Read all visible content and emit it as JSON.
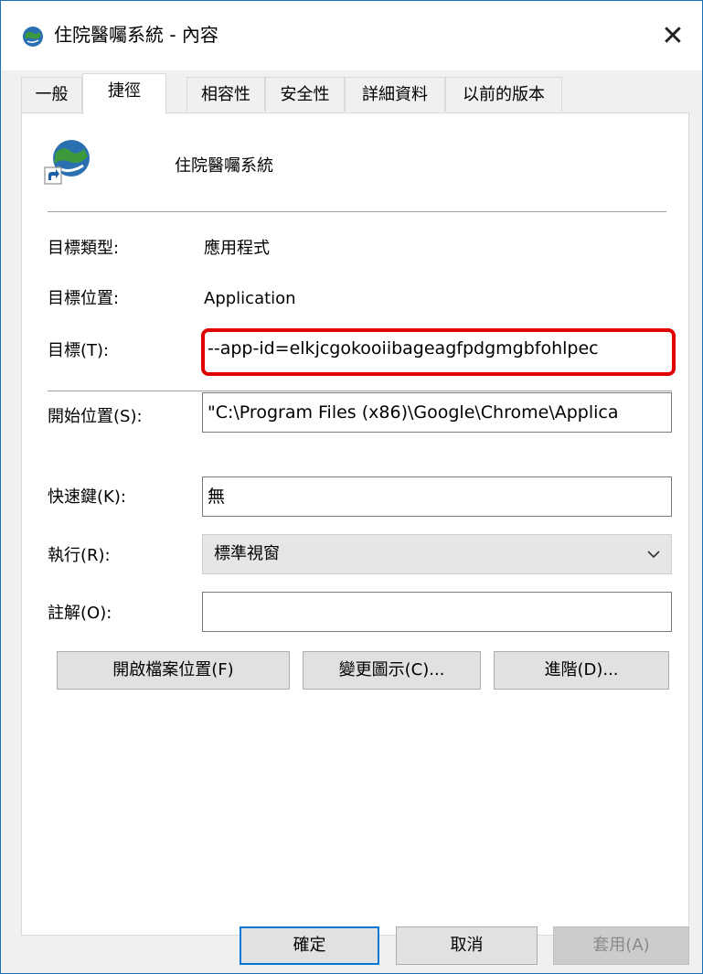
{
  "window": {
    "title": "住院醫囑系統 - 內容",
    "close_glyph": "✕"
  },
  "tabs": [
    {
      "label": "一般"
    },
    {
      "label": "捷徑"
    },
    {
      "label": "相容性"
    },
    {
      "label": "安全性"
    },
    {
      "label": "詳細資料"
    },
    {
      "label": "以前的版本"
    }
  ],
  "shortcut": {
    "name": "住院醫囑系統",
    "target_type_label": "目標類型:",
    "target_type_value": "應用程式",
    "target_location_label": "目標位置:",
    "target_location_value": "Application",
    "target_label": "目標(T):",
    "target_value": "--app-id=elkjcgokooiibageagfpdgmgbfohlpec",
    "start_in_label": "開始位置(S):",
    "start_in_value": "\"C:\\Program Files (x86)\\Google\\Chrome\\Applica",
    "shortcut_key_label": "快速鍵(K):",
    "shortcut_key_value": "無",
    "run_label": "執行(R):",
    "run_value": "標準視窗",
    "comment_label": "註解(O):",
    "comment_value": ""
  },
  "actions": {
    "open_location": "開啟檔案位置(F)",
    "change_icon": "變更圖示(C)...",
    "advanced": "進階(D)..."
  },
  "footer": {
    "ok": "確定",
    "cancel": "取消",
    "apply": "套用(A)"
  },
  "colors": {
    "accent": "#0078d7",
    "highlight": "#e00000"
  }
}
